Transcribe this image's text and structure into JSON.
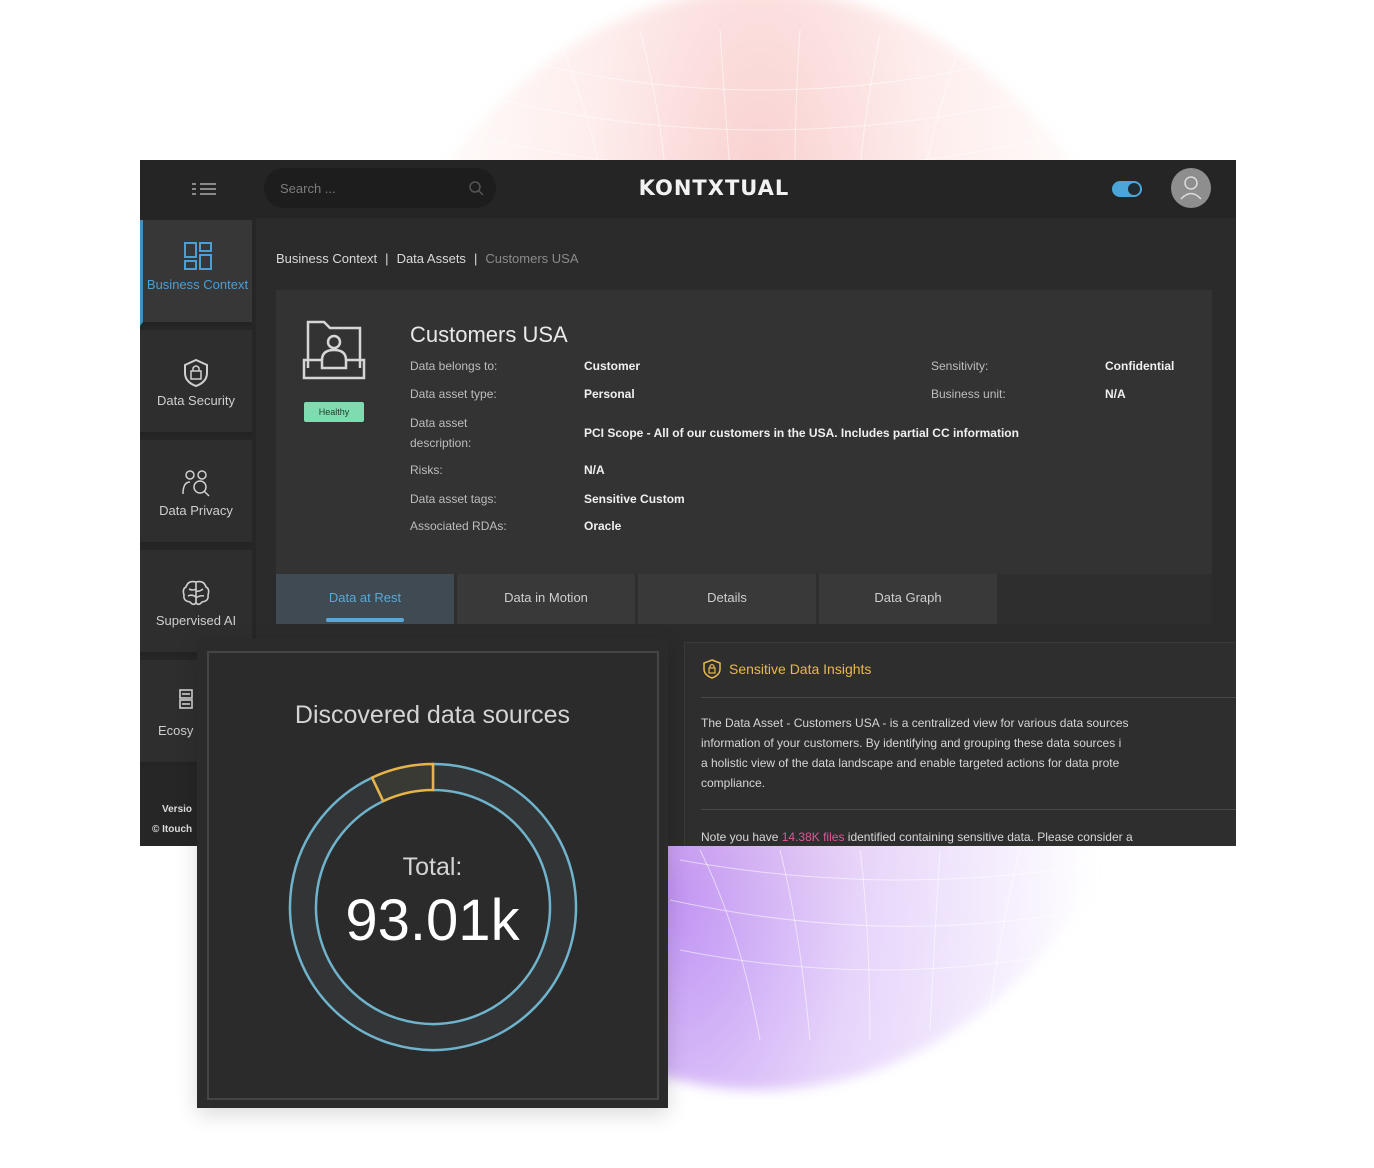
{
  "topbar": {
    "search_placeholder": "Search ...",
    "brand": "KONTXTUAL",
    "icons": [
      "menu-icon",
      "search-icon",
      "user-icon"
    ]
  },
  "sidebar": {
    "items": [
      {
        "label": "Business Context",
        "icon": "dashboard-icon",
        "active": true
      },
      {
        "label": "Data Security",
        "icon": "shield-lock-icon",
        "active": false
      },
      {
        "label": "Data Privacy",
        "icon": "users-search-icon",
        "active": false
      },
      {
        "label": "Supervised AI",
        "icon": "brain-icon",
        "active": false
      },
      {
        "label": "Ecosy",
        "icon": "server-icon",
        "active": false
      }
    ],
    "version_label": "Versio",
    "copyright": "© Itouch"
  },
  "breadcrumb": [
    "Business Context",
    "Data Assets",
    "Customers USA"
  ],
  "asset": {
    "title": "Customers USA",
    "status": "Healthy",
    "fields": {
      "belongs_label": "Data belongs to:",
      "belongs_value": "Customer",
      "type_label": "Data asset type:",
      "type_value": "Personal",
      "desc_label_1": "Data asset",
      "desc_label_2": "description:",
      "desc_value": "PCI Scope - All of our customers in the USA. Includes partial CC information",
      "risks_label": "Risks:",
      "risks_value": "N/A",
      "tags_label": "Data asset tags:",
      "tags_value": "Sensitive Custom",
      "rdas_label": "Associated RDAs:",
      "rdas_value": "Oracle",
      "sensitivity_label": "Sensitivity:",
      "sensitivity_value": "Confidential",
      "unit_label": "Business unit:",
      "unit_value": "N/A"
    }
  },
  "tabs": [
    "Data at Rest",
    "Data in Motion",
    "Details",
    "Data Graph"
  ],
  "insights": {
    "title": "Sensitive Data Insights",
    "body": [
      "The Data Asset - Customers USA - is a centralized view for various data sources",
      "information of your customers. By identifying and grouping these data sources i",
      "a holistic view of the data landscape and enable targeted actions for data prote",
      "compliance."
    ],
    "note_prefix": "Note you have",
    "note_highlight": "14.38K files",
    "note_suffix": "identified containing sensitive data. Please consider a"
  },
  "card": {
    "title": "Discovered data sources",
    "total_label": "Total:",
    "total_value": "93.01k"
  },
  "chart_data": {
    "type": "pie",
    "labels": [],
    "values": [
      0.93,
      0.07
    ],
    "colors": [
      "#6fb3cc",
      "#e7b447"
    ]
  },
  "colors": {
    "accent": "#4a9fd6",
    "healthy": "#7fdcb0",
    "insight": "#e8b94c",
    "highlight": "#e05599"
  }
}
